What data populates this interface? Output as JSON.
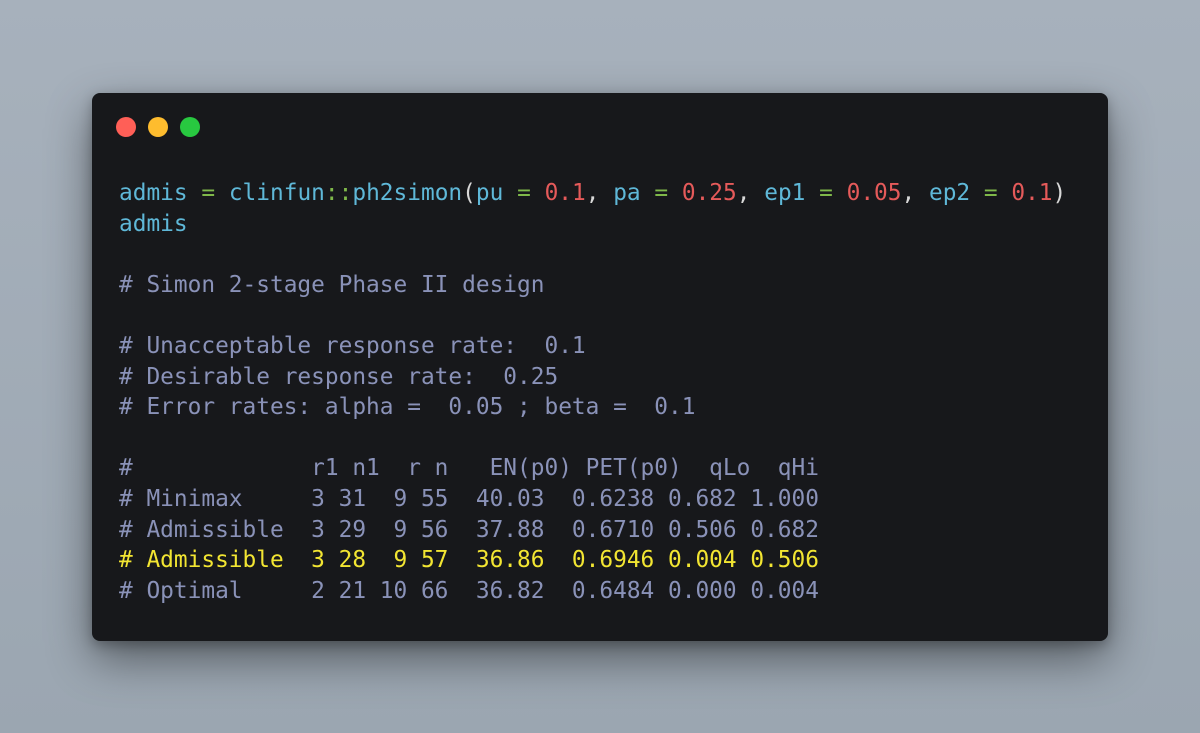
{
  "window": {
    "controls": [
      {
        "name": "close",
        "color": "#ff5f57"
      },
      {
        "name": "minimize",
        "color": "#febc2e"
      },
      {
        "name": "maximize",
        "color": "#28c840"
      }
    ]
  },
  "code": {
    "assign_var": "admis",
    "assign_op": "=",
    "pkg": "clinfun",
    "ns_op": "::",
    "func": "ph2simon",
    "open_paren": "(",
    "args": [
      {
        "name": "pu",
        "eq": "=",
        "value": "0.1",
        "sep": ", "
      },
      {
        "name": "pa",
        "eq": "=",
        "value": "0.25",
        "sep": ", "
      },
      {
        "name": "ep1",
        "eq": "=",
        "value": "0.05",
        "sep": ", "
      },
      {
        "name": "ep2",
        "eq": "=",
        "value": "0.1",
        "sep": ""
      }
    ],
    "close_paren": ")",
    "print_var": "admis"
  },
  "output": {
    "title": "# Simon 2-stage Phase II design",
    "unacceptable": "# Unacceptable response rate:  0.1",
    "desirable": "# Desirable response rate:  0.25",
    "error_rates": "# Error rates: alpha =  0.05 ; beta =  0.1",
    "table_header": "#             r1 n1  r n   EN(p0) PET(p0)  qLo  qHi",
    "rows": [
      "# Minimax     3 31  9 55  40.03  0.6238 0.682 1.000",
      "# Admissible  3 29  9 56  37.88  0.6710 0.506 0.682",
      "# Admissible  3 28  9 57  36.86  0.6946 0.004 0.506",
      "# Optimal     2 21 10 66  36.82  0.6484 0.000 0.004"
    ],
    "highlight_color": "#f2e532"
  },
  "colors": {
    "background": "#17181b",
    "identifier": "#5fb8d8",
    "operator": "#7fb84a",
    "number": "#e55a5a",
    "comment": "#8a92b8"
  }
}
